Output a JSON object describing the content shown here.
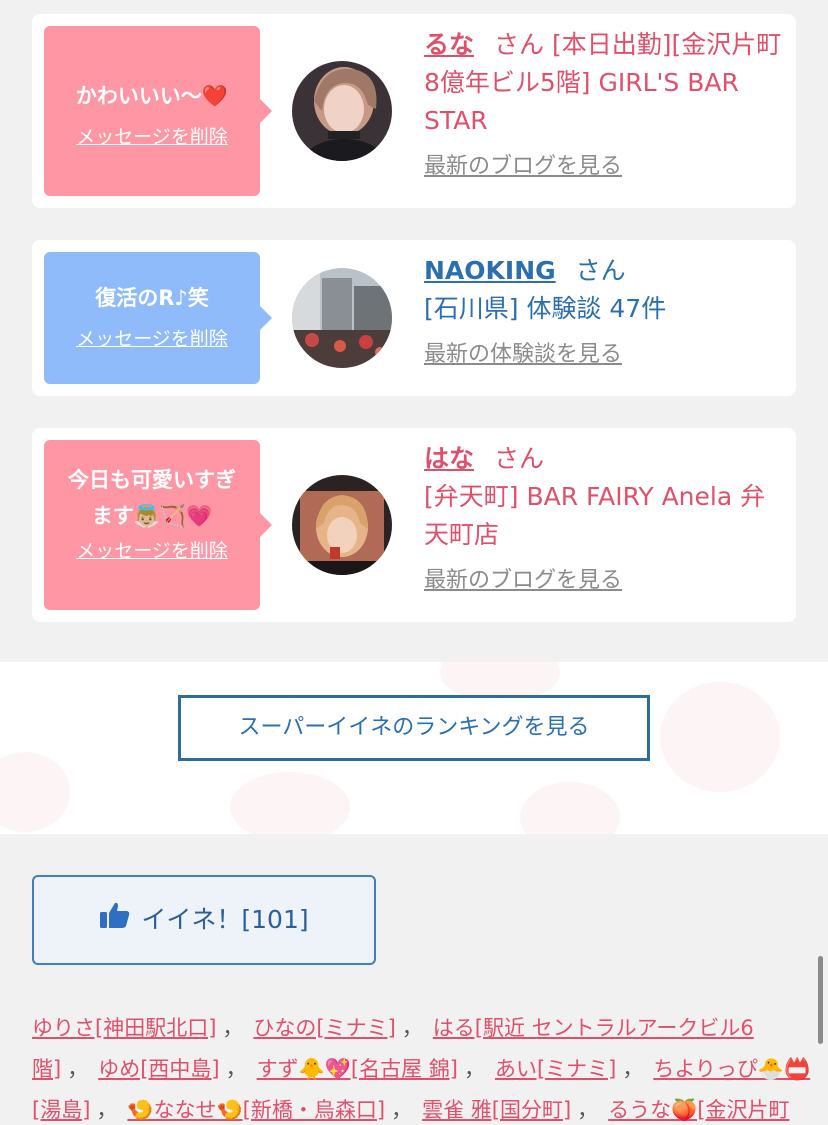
{
  "cards": [
    {
      "message": "かわいいい〜❤️",
      "delete_label": "メッセージを削除",
      "name": "るな",
      "honorific": "さん",
      "desc": "[本日出勤][金沢片町 8億年ビル5階] GIRL'S BAR STAR",
      "more": "最新のブログを見る"
    },
    {
      "message": "復活のR♪笑",
      "delete_label": "メッセージを削除",
      "name": "NAOKING",
      "honorific": "さん",
      "desc": "[石川県] 体験談 47件",
      "more": "最新の体験談を見る"
    },
    {
      "message": "今日も可愛いすぎます👼🏼🏹💗",
      "delete_label": "メッセージを削除",
      "name": "はな",
      "honorific": "さん",
      "desc": "[弁天町] BAR FAIRY Anela 弁天町店",
      "more": "最新のブログを見る"
    }
  ],
  "ranking_button": "スーパーイイネのランキングを見る",
  "like_button": "イイネ！[101]",
  "likers": [
    "ゆりさ[神田駅北口]",
    "ひなの[ミナミ]",
    "はる[駅近 セントラルアークビル6階]",
    "ゆめ[西中島]",
    "すず🐥💖[名古屋 錦]",
    "あい[ミナミ]",
    "ちよりっぴ🐣📛[湯島]",
    "🍤ななせ🍤[新橋・烏森口]",
    "雲雀 雅[国分町]",
    "るうな🍑[金沢片町"
  ],
  "colors": {
    "accent_red": "#e0506a",
    "accent_blue": "#2b6fb1",
    "bubble_pink": "#fe97a3",
    "bubble_blue": "#8fbbfb"
  }
}
